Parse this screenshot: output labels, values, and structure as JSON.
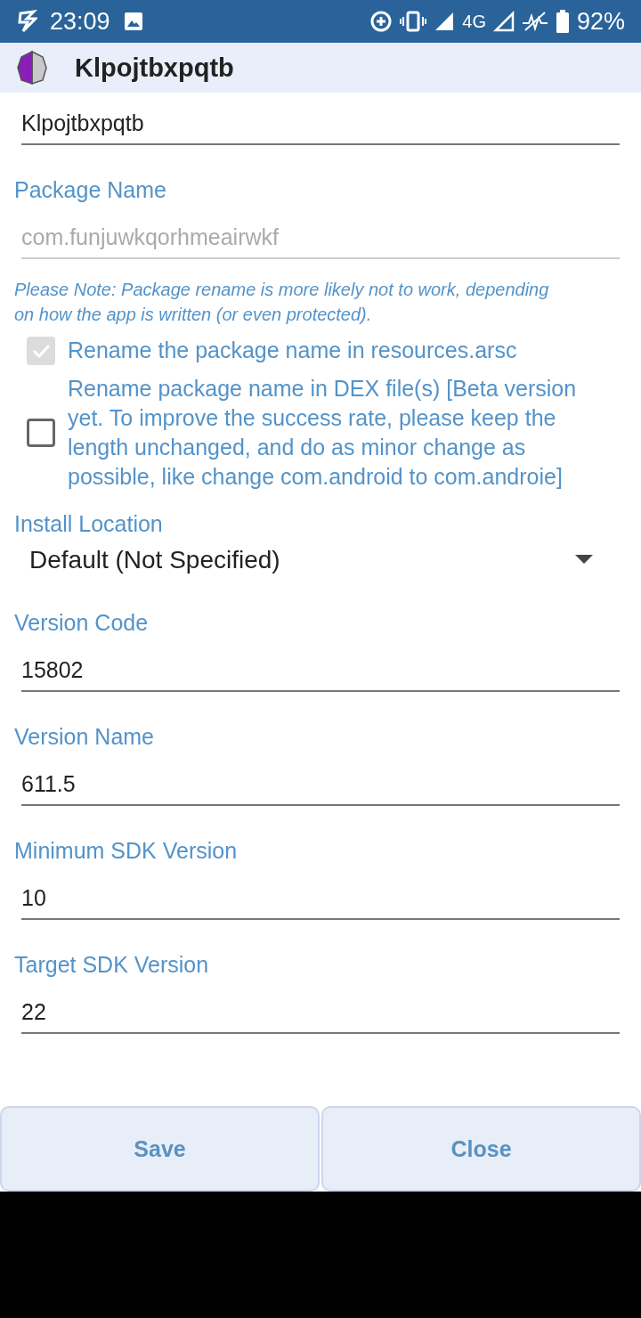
{
  "status_bar": {
    "time": "23:09",
    "network": "4G",
    "battery": "92%"
  },
  "app_bar": {
    "title": "Klpojtbxpqtb"
  },
  "name_field": {
    "value": "Klpojtbxpqtb"
  },
  "package": {
    "label": "Package Name",
    "value": "com.funjuwkqorhmeairwkf",
    "disabled": true
  },
  "note": "Please Note: Package rename is more likely not to work, depending on how the app is written (or even protected).",
  "checkboxes": [
    {
      "label": "Rename the package name in resources.arsc",
      "checked": true,
      "disabled": true
    },
    {
      "label": "Rename package name in DEX file(s) [Beta version yet. To improve the success rate, please keep the length unchanged, and do as minor change as possible, like change com.android to com.androie]",
      "checked": false,
      "disabled": false
    }
  ],
  "install_location": {
    "label": "Install Location",
    "value": "Default (Not Specified)"
  },
  "fields": [
    {
      "label": "Version Code",
      "value": "15802"
    },
    {
      "label": "Version Name",
      "value": "611.5"
    },
    {
      "label": "Minimum SDK Version",
      "value": "10"
    },
    {
      "label": "Target SDK Version",
      "value": "22"
    }
  ],
  "buttons": [
    "Save",
    "Close"
  ]
}
